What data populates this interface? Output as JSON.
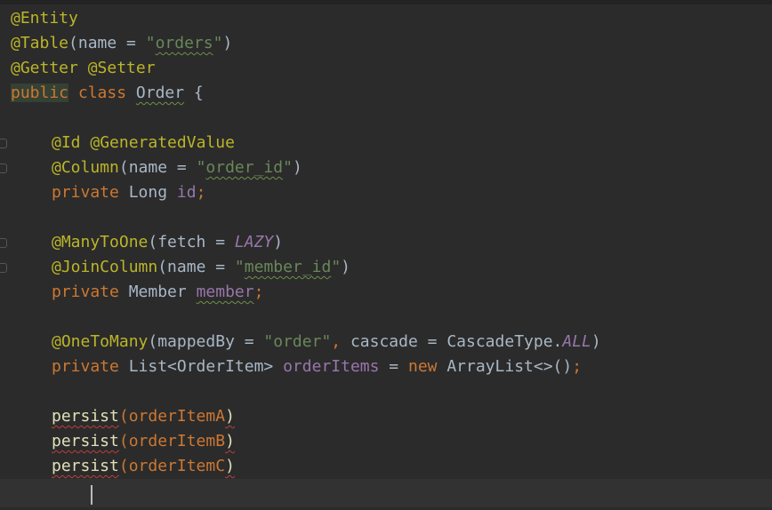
{
  "code": {
    "l1_ann": "@Entity",
    "l2_ann": "@Table",
    "l2_open": "(name = ",
    "l2_q1": "\"",
    "l2_str": "orders",
    "l2_q2": "\"",
    "l2_close": ")",
    "l3_ann1": "@Getter",
    "l3_sp": " ",
    "l3_ann2": "@Setter",
    "l4_public": "public",
    "l4_class": " class ",
    "l4_name": "Order",
    "l4_brace": " {",
    "l6_ann1": "@Id",
    "l6_sp": " ",
    "l6_ann2": "@GeneratedValue",
    "l7_ann": "@Column",
    "l7_open": "(name = ",
    "l7_q1": "\"",
    "l7_str": "order_id",
    "l7_q2": "\"",
    "l7_close": ")",
    "l8_private": "private",
    "l8_type": " Long ",
    "l8_field": "id",
    "l8_semi": ";",
    "l10_ann": "@ManyToOne",
    "l10_open": "(fetch = ",
    "l10_const": "LAZY",
    "l10_close": ")",
    "l11_ann": "@JoinColumn",
    "l11_open": "(name = ",
    "l11_q1": "\"",
    "l11_str": "member_id",
    "l11_q2": "\"",
    "l11_close": ")",
    "l12_private": "private",
    "l12_type": " Member ",
    "l12_field": "member",
    "l12_semi": ";",
    "l14_ann": "@OneToMany",
    "l14_open": "(mappedBy = ",
    "l14_str": "\"order\"",
    "l14_comma": ",",
    "l14_mid": " cascade = CascadeType.",
    "l14_const": "ALL",
    "l14_close": ")",
    "l15_private": "private",
    "l15_type": " List<OrderItem> ",
    "l15_field": "orderItems",
    "l15_eq": " = ",
    "l15_new": "new",
    "l15_rest": " ArrayList<>()",
    "l15_semi": ";",
    "l17_call": "persist",
    "l17_open": "(",
    "l17_arg": "orderItemA",
    "l17_close": ")",
    "l18_call": "persist",
    "l18_open": "(",
    "l18_arg": "orderItemB",
    "l18_close": ")",
    "l19_call": "persist",
    "l19_open": "(",
    "l19_arg": "orderItemC",
    "l19_close": ")"
  },
  "colors": {
    "background": "#2b2b2b",
    "annotation": "#bbb529",
    "keyword": "#cc7832",
    "string": "#6a8759",
    "field": "#9876aa",
    "text": "#a9b7c6",
    "error_underline": "#bc3f3c"
  }
}
